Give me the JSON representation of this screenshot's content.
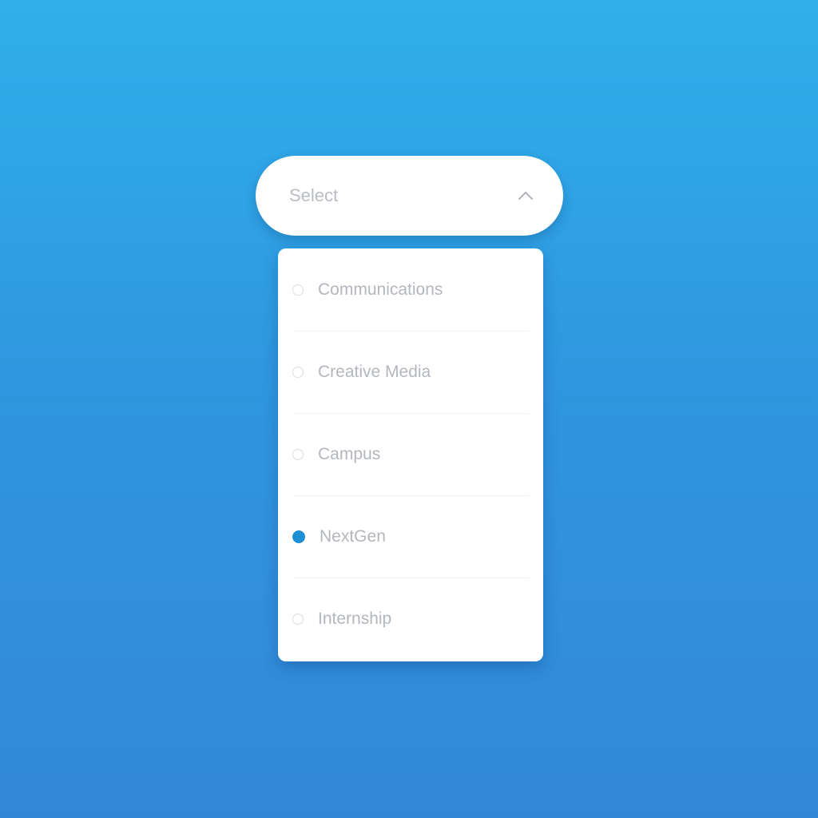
{
  "select": {
    "label": "Select",
    "state": "open",
    "chevron_icon": "chevron-up-icon"
  },
  "options": [
    {
      "label": "Communications",
      "selected": false
    },
    {
      "label": "Creative Media",
      "selected": false
    },
    {
      "label": "Campus",
      "selected": false
    },
    {
      "label": "NextGen",
      "selected": true
    },
    {
      "label": "Internship",
      "selected": false
    }
  ],
  "colors": {
    "background_top": "#2fb0ea",
    "background_bottom": "#3387d8",
    "accent": "#1e8fd4",
    "text_muted": "#b3b7bd"
  }
}
